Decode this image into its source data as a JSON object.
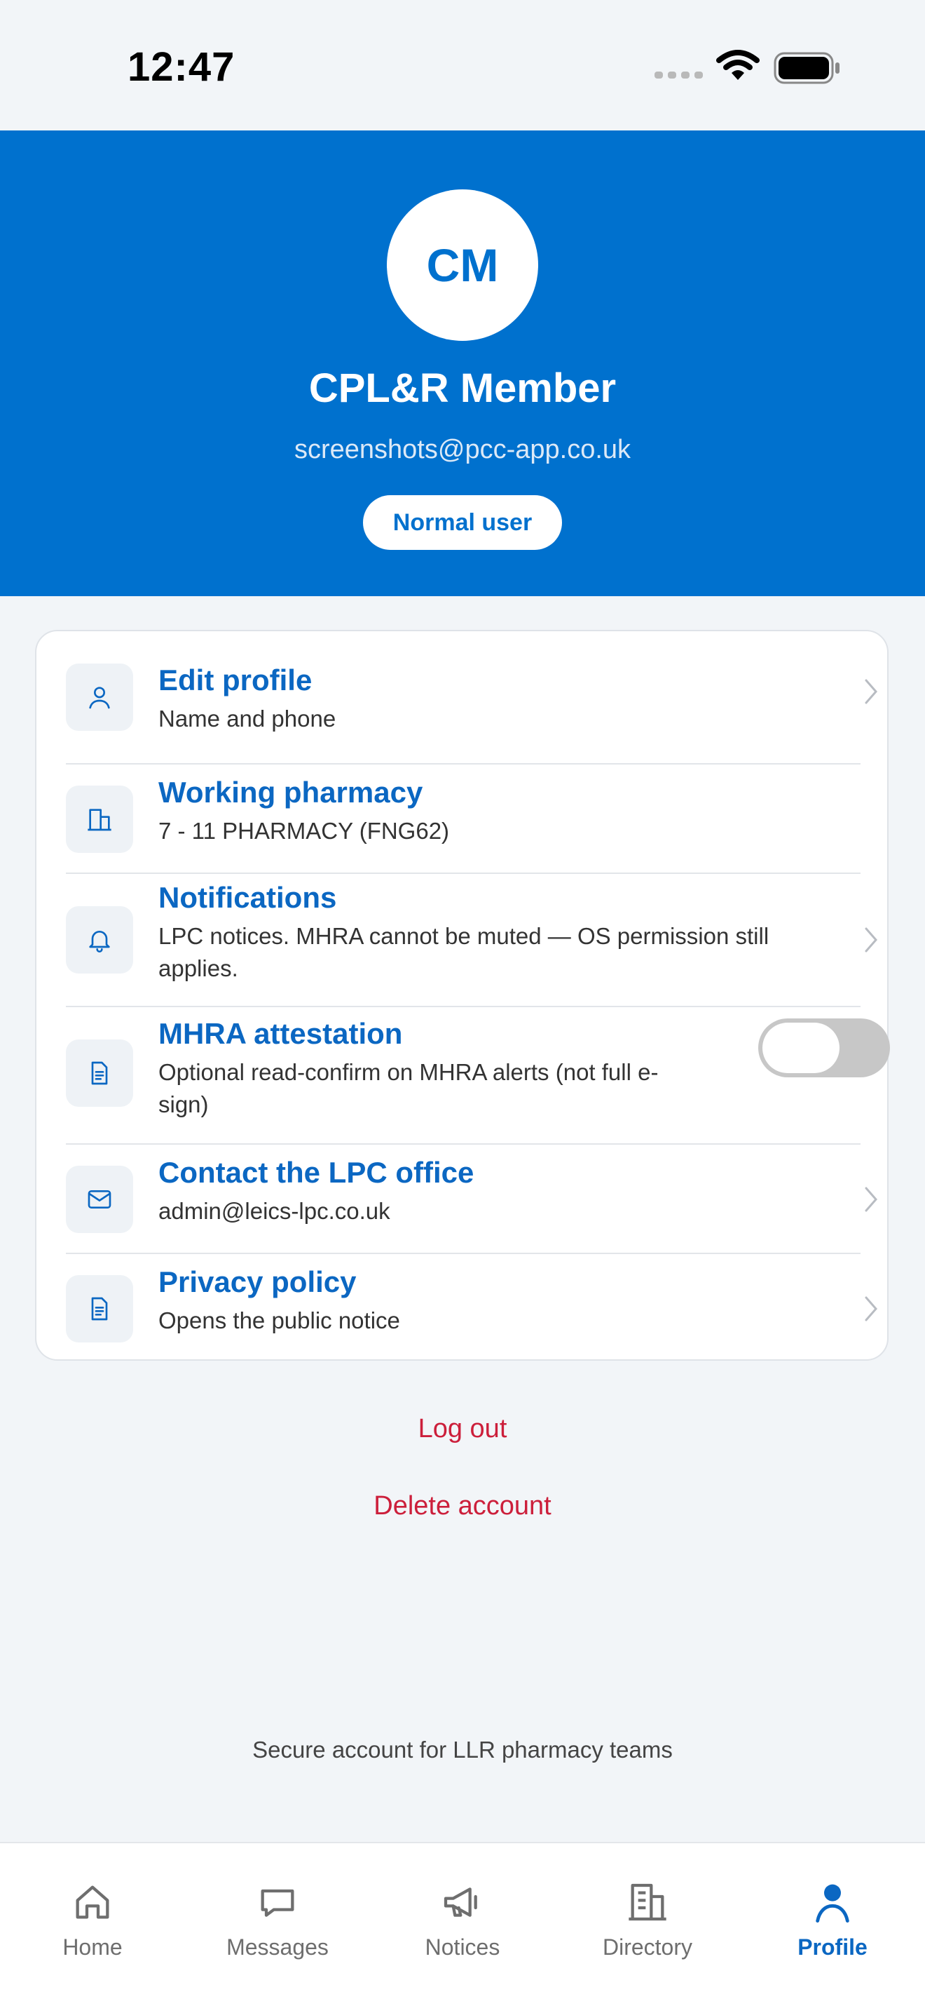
{
  "status_bar": {
    "time": "12:47"
  },
  "profile": {
    "initials": "CM",
    "name": "CPL&R Member",
    "email": "screenshots@pcc-app.co.uk",
    "role": "Normal user"
  },
  "settings": [
    {
      "title": "Edit profile",
      "subtitle": "Name and phone",
      "icon": "person-icon"
    },
    {
      "title": "Working pharmacy",
      "subtitle": "7 - 11 PHARMACY (FNG62)",
      "icon": "building-icon"
    },
    {
      "title": "Notifications",
      "subtitle": "LPC notices. MHRA cannot be muted — OS permission still applies.",
      "icon": "bell-icon"
    },
    {
      "title": "MHRA attestation",
      "subtitle": "Optional read-confirm on MHRA alerts (not full e-sign)",
      "icon": "document-icon",
      "toggle": false
    },
    {
      "title": "Contact the LPC office",
      "subtitle": "admin@leics-lpc.co.uk",
      "icon": "mail-icon"
    },
    {
      "title": "Privacy policy",
      "subtitle": "Opens the public notice",
      "icon": "document-icon"
    }
  ],
  "actions": {
    "logout": "Log out",
    "delete": "Delete account"
  },
  "footer_note": "Secure account for LLR pharmacy teams",
  "tabs": [
    {
      "label": "Home",
      "icon": "home-icon"
    },
    {
      "label": "Messages",
      "icon": "chat-icon"
    },
    {
      "label": "Notices",
      "icon": "megaphone-icon"
    },
    {
      "label": "Directory",
      "icon": "building-icon"
    },
    {
      "label": "Profile",
      "icon": "person-icon",
      "active": true
    }
  ],
  "colors": {
    "brand": "#0071ce",
    "link": "#0b67c2",
    "danger": "#cc1f3b",
    "background": "#f2f5f8"
  }
}
